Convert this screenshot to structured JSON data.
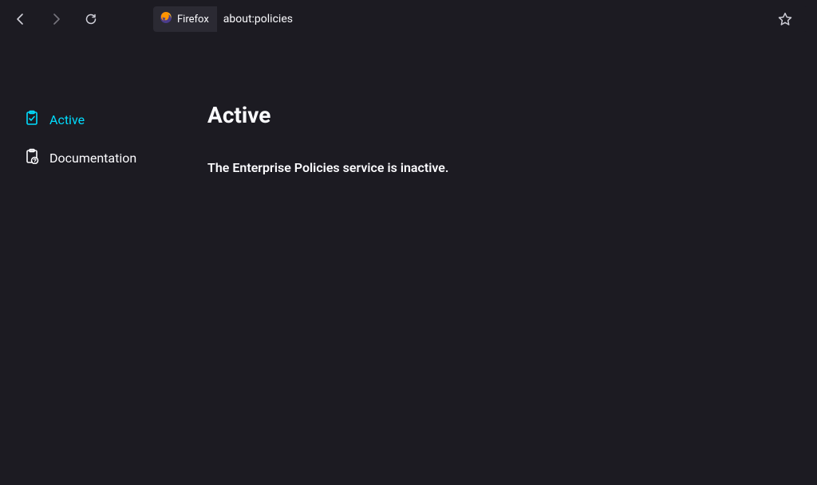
{
  "toolbar": {
    "identity_label": "Firefox",
    "url": "about:policies"
  },
  "sidebar": {
    "items": [
      {
        "label": "Active"
      },
      {
        "label": "Documentation"
      }
    ]
  },
  "main": {
    "title": "Active",
    "message": "The Enterprise Policies service is inactive."
  }
}
